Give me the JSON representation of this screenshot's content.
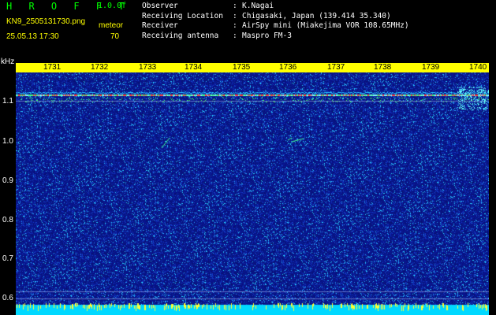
{
  "header": {
    "title": "H R O F F T",
    "version": "1.0.0f",
    "filename": "KN9_2505131730.png",
    "meteor_label": "meteor",
    "datetime": "25.05.13 17:30",
    "count": "70"
  },
  "info": [
    {
      "key": "Observer",
      "sep": ":",
      "value": "K.Nagai"
    },
    {
      "key": "Receiving Location",
      "sep": ":",
      "value": "Chigasaki, Japan (139.414 35.340)"
    },
    {
      "key": "Receiver",
      "sep": ":",
      "value": "AirSpy mini (Miakejima VOR 108.65MHz)"
    },
    {
      "key": "Receiving antenna",
      "sep": ":",
      "value": "Maspro FM-3"
    }
  ],
  "axis": {
    "unit": "kHz",
    "y_labels": [
      "1.1",
      "1.0",
      "0.9",
      "0.8",
      "0.7",
      "0.6"
    ],
    "time_labels": [
      "1731",
      "1732",
      "1733",
      "1734",
      "1735",
      "1736",
      "1737",
      "1738",
      "1739",
      "1740"
    ]
  },
  "colors": {
    "background": "#000000",
    "title": "#00ff00",
    "meta": "#ffff00",
    "noise_base": "#0a1a7a",
    "ruler": "#ffff00",
    "bottom_band": "#00d8ff"
  }
}
